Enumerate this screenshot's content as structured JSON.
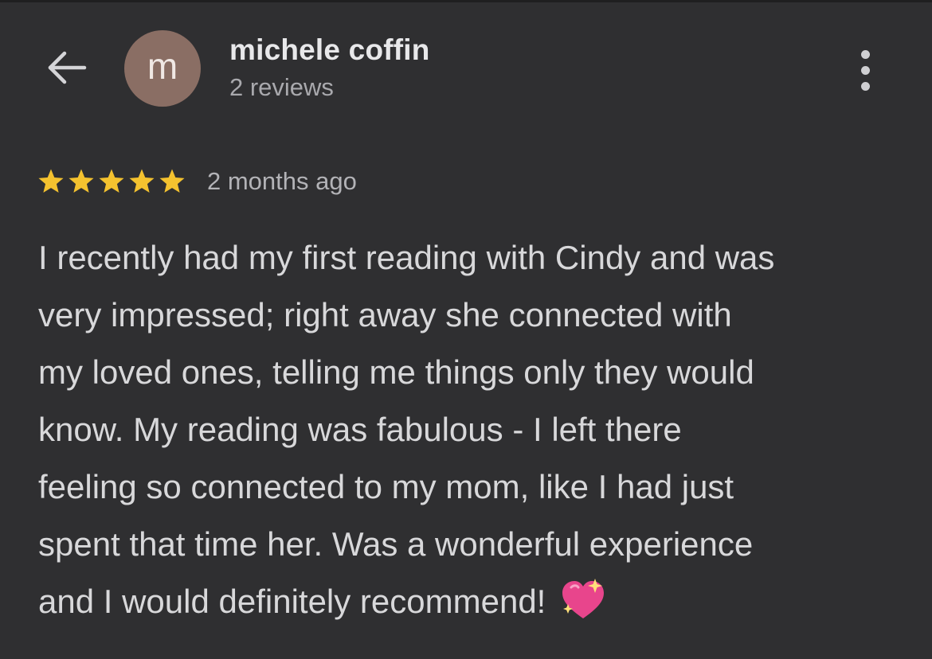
{
  "header": {
    "avatar_letter": "m",
    "reviewer_name": "michele coffin",
    "review_count": "2 reviews",
    "icons": {
      "back": "back-arrow-icon",
      "more": "more-vertical-icon"
    }
  },
  "review": {
    "rating": 5,
    "rating_max": 5,
    "date": "2 months ago",
    "lines": [
      "I recently had my first reading with Cindy and was",
      "very impressed; right away she connected with",
      "my loved ones, telling me things only they would",
      "know. My reading was fabulous - I left there",
      "feeling so connected to my mom, like I had just",
      "spent that time her. Was a wonderful experience",
      "and I would definitely recommend!"
    ],
    "emoji": "sparkling-heart-icon"
  },
  "colors": {
    "background": "#2f2f31",
    "star": "#f4c22f",
    "avatar": "#8a6e64",
    "name_text": "#e8e8ea",
    "secondary_text": "#a9a9ad",
    "body_text": "#d8d8da",
    "heart": "#e8458c"
  }
}
